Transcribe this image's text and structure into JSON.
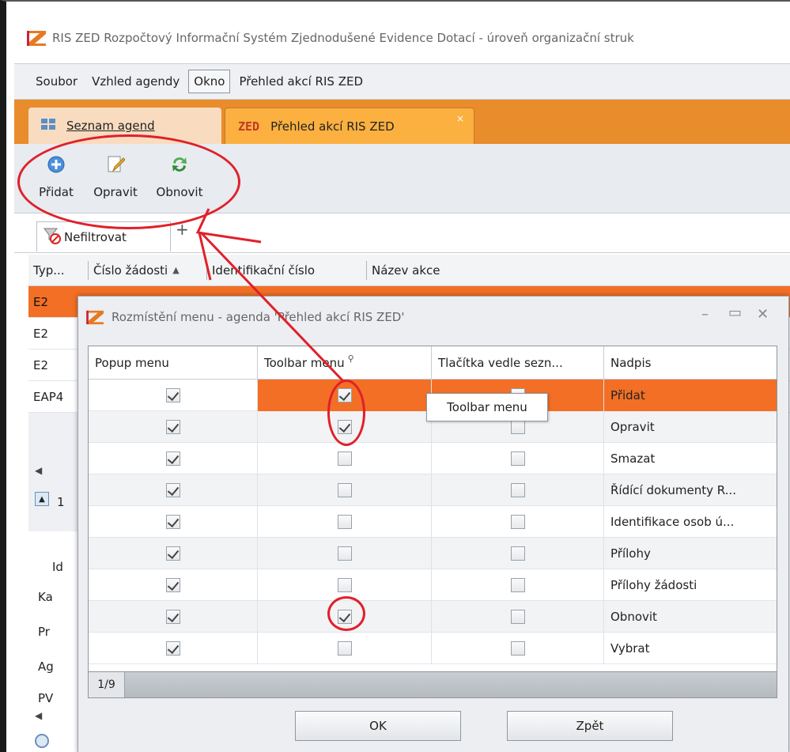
{
  "window": {
    "title": "RIS ZED Rozpočtový Informační Systém Zjednodušené Evidence Dotací - úroveň organizační struk"
  },
  "menubar": {
    "items": [
      "Soubor",
      "Vzhled agendy",
      "Okno",
      "Přehled akcí RIS ZED"
    ]
  },
  "tabs": [
    {
      "label": "Seznam agend",
      "icon": "grid-icon"
    },
    {
      "label": "Přehled akcí RIS ZED",
      "icon": "zed-logo-icon"
    }
  ],
  "toolbar": {
    "add_label": "Přidat",
    "edit_label": "Opravit",
    "refresh_label": "Obnovit"
  },
  "filter": {
    "tab_label": "Nefiltrovat",
    "add_tab_label": "+"
  },
  "grid": {
    "columns": [
      "Typ...",
      "Číslo žádosti",
      "Identifikační číslo",
      "Název akce"
    ],
    "rows": [
      "E2",
      "E2",
      "E2",
      "EAP4"
    ]
  },
  "left_pane": {
    "labels": [
      "1",
      "Id",
      "Ka",
      "Pr",
      "Ag",
      "PV"
    ]
  },
  "dialog": {
    "title": "Rozmístění menu - agenda 'Přehled akcí RIS ZED'",
    "columns": [
      "Popup menu",
      "Toolbar menu",
      "Tlačítka vedle sezn...",
      "Nadpis"
    ],
    "rows": [
      {
        "popup": true,
        "toolbar": true,
        "buttons": false,
        "caption": "Přidat"
      },
      {
        "popup": true,
        "toolbar": true,
        "buttons": false,
        "caption": "Opravit"
      },
      {
        "popup": true,
        "toolbar": false,
        "buttons": false,
        "caption": "Smazat"
      },
      {
        "popup": true,
        "toolbar": false,
        "buttons": false,
        "caption": "Řídící dokumenty R..."
      },
      {
        "popup": true,
        "toolbar": false,
        "buttons": false,
        "caption": "Identifikace osob ú..."
      },
      {
        "popup": true,
        "toolbar": false,
        "buttons": false,
        "caption": "Přílohy"
      },
      {
        "popup": true,
        "toolbar": false,
        "buttons": false,
        "caption": "Přílohy žádosti"
      },
      {
        "popup": true,
        "toolbar": true,
        "buttons": false,
        "caption": "Obnovit"
      },
      {
        "popup": true,
        "toolbar": false,
        "buttons": false,
        "caption": "Vybrat"
      }
    ],
    "record_position": "1/9",
    "tooltip": "Toolbar menu",
    "ok_label": "OK",
    "back_label": "Zpět"
  },
  "colors": {
    "accent": "#f26f25",
    "tab_strip": "#e88c2c",
    "annotation": "#e0202a"
  }
}
